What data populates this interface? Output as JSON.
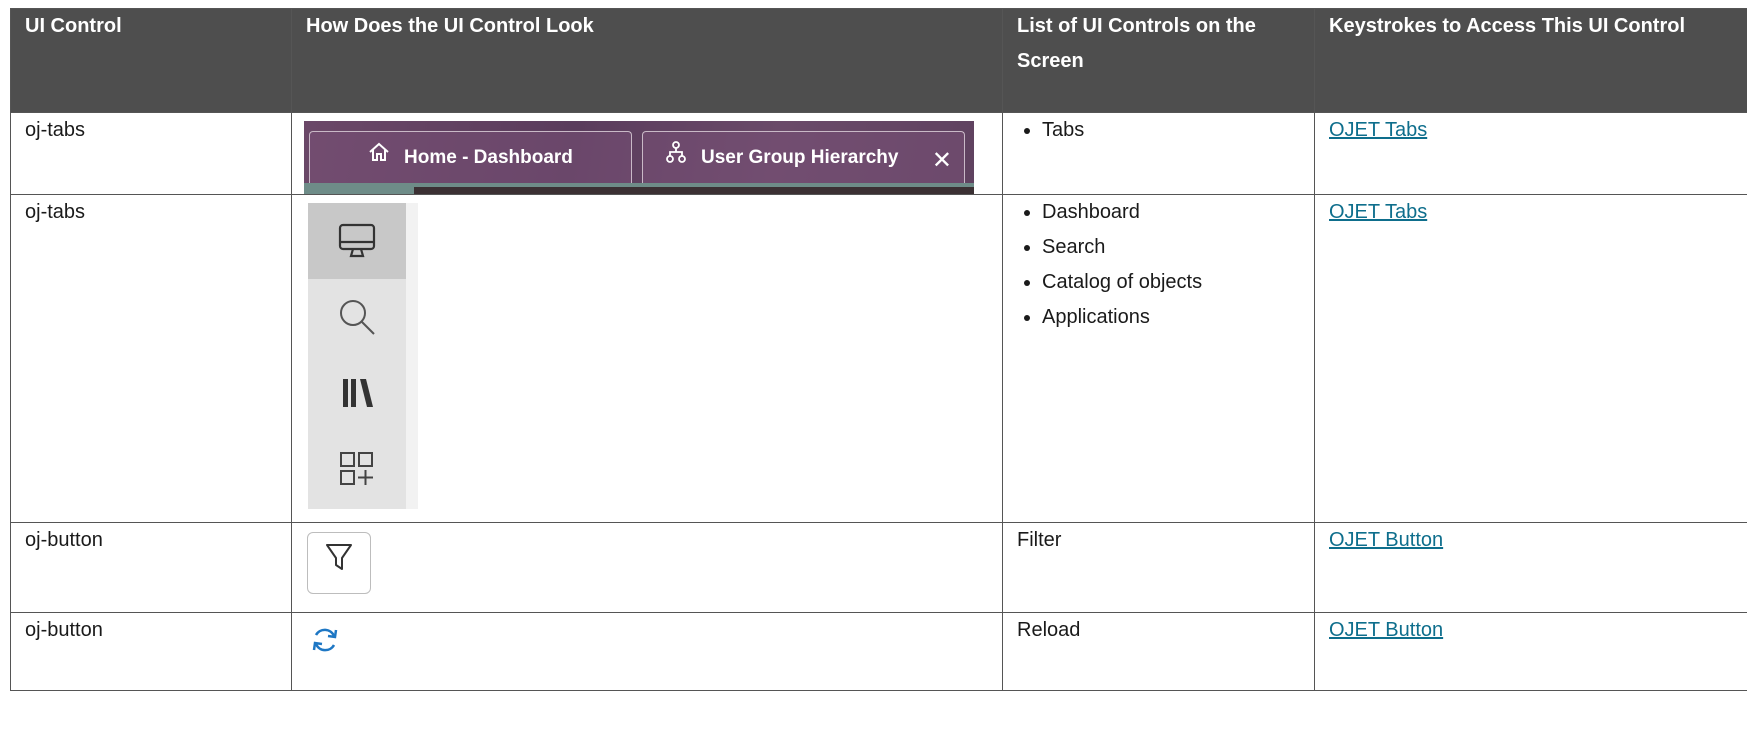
{
  "headers": {
    "ui_control": "UI Control",
    "look": "How Does the UI Control Look",
    "list": "List of UI Controls on the Screen",
    "keystrokes": "Keystrokes to Access This UI Control"
  },
  "rows": [
    {
      "ui_control": "oj-tabs",
      "look": {
        "tabs": [
          "Home - Dashboard",
          "User Group Hierarchy"
        ]
      },
      "list_items": [
        "Tabs"
      ],
      "link": "OJET Tabs"
    },
    {
      "ui_control": "oj-tabs",
      "look": {
        "icons": [
          "monitor-icon",
          "search-icon",
          "library-icon",
          "add-apps-icon"
        ]
      },
      "list_items": [
        "Dashboard",
        "Search",
        "Catalog of objects",
        "Applications"
      ],
      "link": "OJET Tabs"
    },
    {
      "ui_control": "oj-button",
      "look": {
        "icon": "filter-icon"
      },
      "list_text": "Filter",
      "link": "OJET Button"
    },
    {
      "ui_control": "oj-button",
      "look": {
        "icon": "reload-icon"
      },
      "list_text": "Reload",
      "link": "OJET Button"
    }
  ],
  "colors": {
    "header_bg": "#4e4e4e",
    "link": "#0e6e8c",
    "tab_bg": "#5f4260",
    "reload_blue": "#1e77c4"
  }
}
